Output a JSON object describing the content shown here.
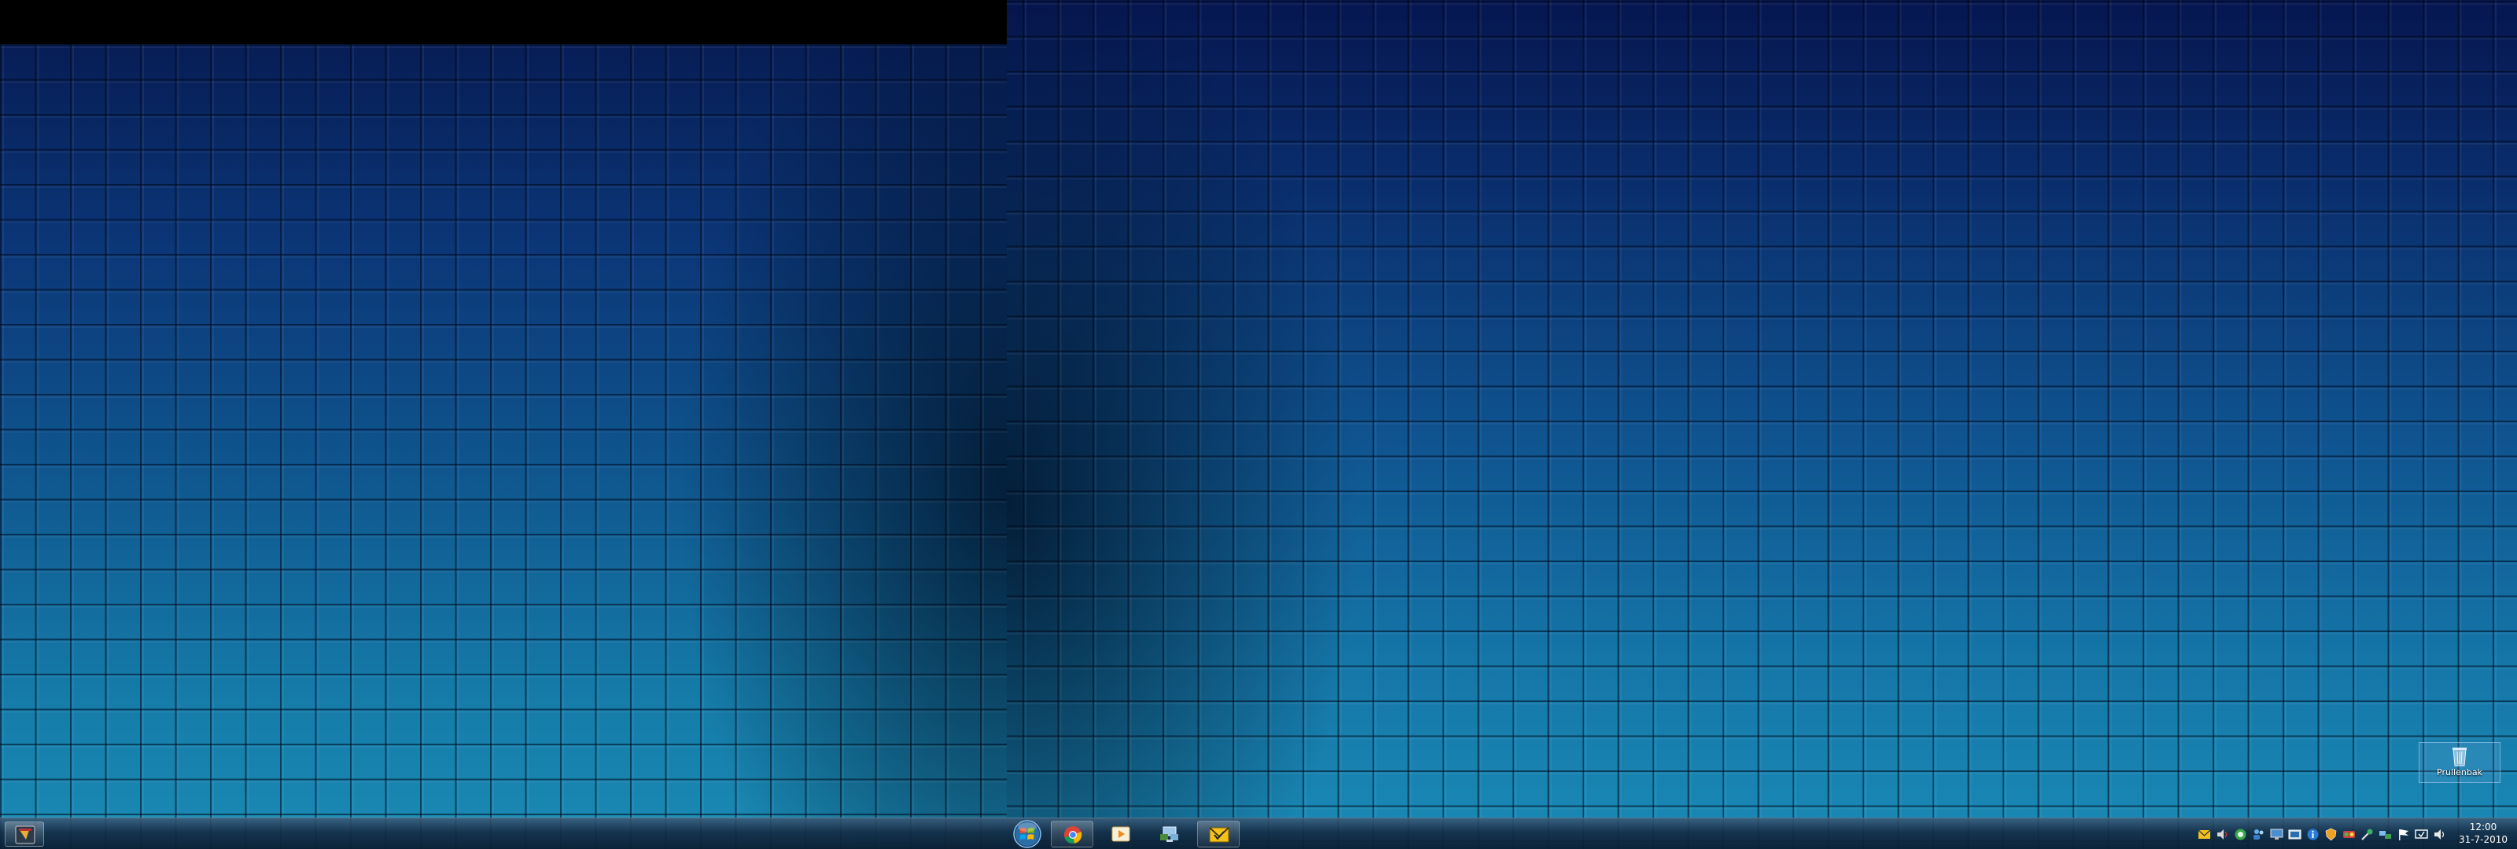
{
  "desktop": {
    "icons": [
      {
        "label": "Prullenbak",
        "icon": "recycle-bin-icon"
      }
    ]
  },
  "taskbar_left": {
    "start_button_icon": "start-thumbnail-icon"
  },
  "taskbar_right": {
    "start_icon": "windows-start-orb-icon",
    "pinned": [
      {
        "icon": "chrome-icon"
      },
      {
        "icon": "media-player-icon"
      },
      {
        "icon": "network-folder-icon"
      },
      {
        "icon": "mail-envelope-icon"
      }
    ],
    "tray_icons": [
      "mail-tray-icon",
      "volume-tray-icon",
      "green-circle-tray-icon",
      "people-tray-icon",
      "monitor-tray-icon",
      "display-tray-icon",
      "info-tray-icon",
      "shield-tray-icon",
      "antivirus-tray-icon",
      "tool-tray-icon",
      "network-tray-icon",
      "flag-tray-icon",
      "sync-tray-icon",
      "speaker-tray-icon"
    ],
    "clock": {
      "time": "12:00",
      "date": "31-7-2010"
    }
  },
  "colors": {
    "wallpaper_top": "#071d55",
    "wallpaper_bottom": "#1a8bb4",
    "taskbar": "#143250"
  }
}
